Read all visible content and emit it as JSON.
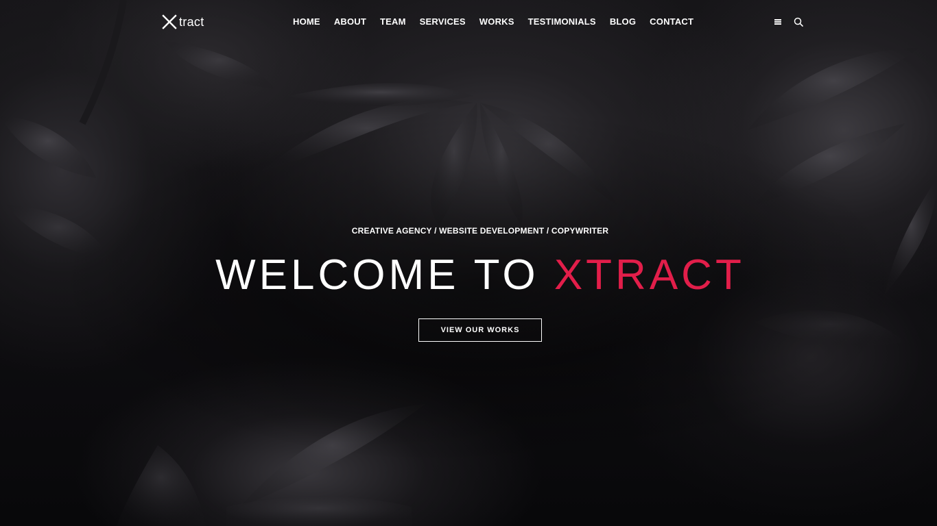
{
  "brand": {
    "logo_text": "tract",
    "accent_color": "#e21e4a"
  },
  "nav": {
    "items": [
      {
        "label": "HOME"
      },
      {
        "label": "ABOUT"
      },
      {
        "label": "TEAM"
      },
      {
        "label": "SERVICES"
      },
      {
        "label": "WORKS"
      },
      {
        "label": "TESTIMONIALS"
      },
      {
        "label": "BLOG"
      },
      {
        "label": "CONTACT"
      }
    ],
    "icons": [
      "menu-icon",
      "search-icon"
    ]
  },
  "hero": {
    "tagline": "CREATIVE AGENCY / WEBSITE DEVELOPMENT / COPYWRITER",
    "headline_plain": "WELCOME TO ",
    "headline_accent": "XTRACT",
    "cta_label": "VIEW OUR WORKS"
  }
}
